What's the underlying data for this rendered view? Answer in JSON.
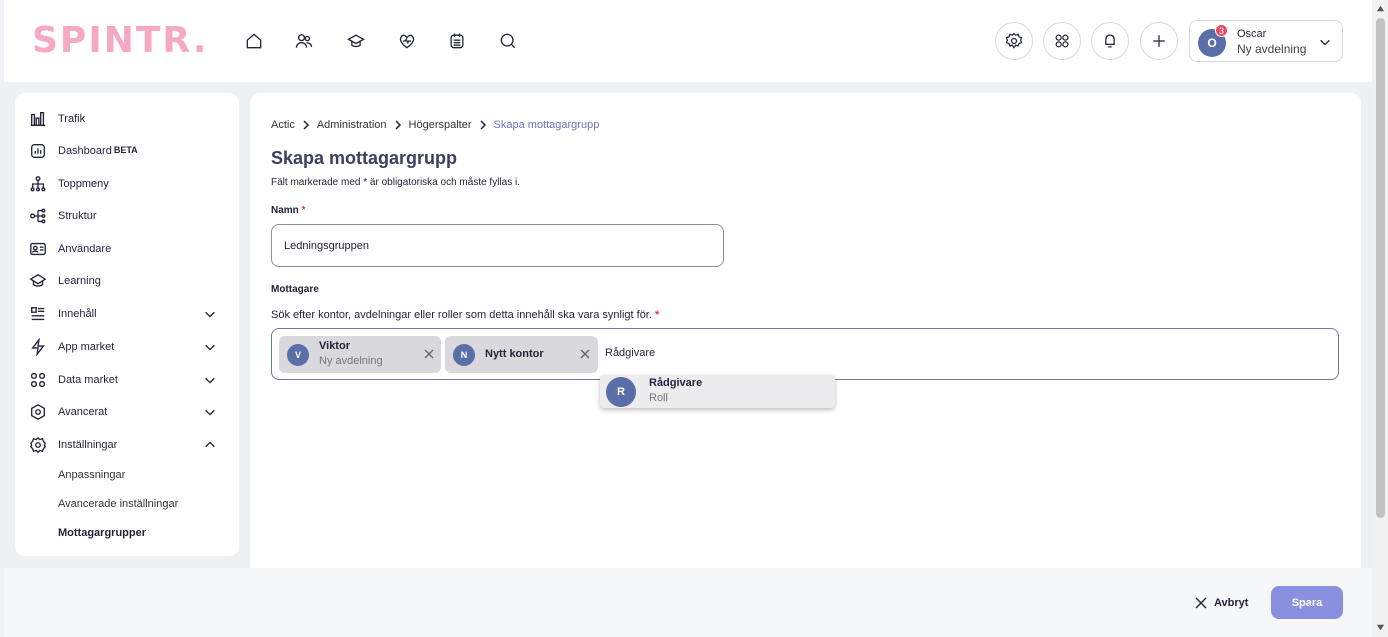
{
  "header": {
    "logo": "SPINTR.",
    "nav_icons": [
      "home-icon",
      "people-icon",
      "learning-icon",
      "health-icon",
      "calendar-icon",
      "search-icon"
    ],
    "actions": [
      "settings-icon",
      "apps-icon",
      "bell-icon",
      "plus-icon"
    ],
    "user": {
      "initial": "O",
      "badge": "3",
      "name": "Oscar",
      "department": "Ny avdelning"
    }
  },
  "sidebar": {
    "items": [
      {
        "label": "Trafik",
        "icon": "traffic-chart-icon"
      },
      {
        "label": "Dashboard",
        "beta": "BETA",
        "icon": "dashboard-icon"
      },
      {
        "label": "Toppmeny",
        "icon": "hierarchy-icon"
      },
      {
        "label": "Struktur",
        "icon": "structure-icon"
      },
      {
        "label": "Användare",
        "icon": "user-card-icon"
      },
      {
        "label": "Learning",
        "icon": "learning-icon"
      },
      {
        "label": "Innehåll",
        "icon": "content-list-icon"
      },
      {
        "label": "App market",
        "icon": "lightning-icon"
      },
      {
        "label": "Data market",
        "icon": "grid-icon"
      },
      {
        "label": "Avancerat",
        "icon": "hexagon-icon"
      },
      {
        "label": "Inställningar",
        "icon": "settings-icon"
      }
    ],
    "sub_items": [
      {
        "label": "Anpassningar"
      },
      {
        "label": "Avancerade inställningar"
      },
      {
        "label": "Mottagargrupper"
      }
    ]
  },
  "main": {
    "breadcrumb": [
      "Actic",
      "Administration",
      "Högerspalter",
      "Skapa mottagargrupp"
    ],
    "title": "Skapa mottagargrupp",
    "subtitle": "Fält markerade med * är obligatoriska och måste fyllas i.",
    "name_label": "Namn",
    "required_mark": "*",
    "name_value": "Ledningsgruppen",
    "recipients_label": "Mottagare",
    "recipients_help": "Sök efter kontor, avdelningar eller roller som detta innehåll ska vara synligt för.",
    "chips": [
      {
        "initial": "V",
        "name": "Viktor",
        "sub": "Ny avdelning"
      },
      {
        "initial": "N",
        "name": "Nytt kontor",
        "sub": ""
      }
    ],
    "search_text": "Rådgivare",
    "suggestion": {
      "initial": "R",
      "name": "Rådgivare",
      "sub": "Roll"
    }
  },
  "footer": {
    "cancel_label": "Avbryt",
    "save_label": "Spara"
  },
  "colors": {
    "accent": "#8b8fe0",
    "logo": "#f7a8c4",
    "avatar": "#5a6ea8",
    "required": "#e0334a",
    "breadcrumb_current": "#6b74c8"
  }
}
